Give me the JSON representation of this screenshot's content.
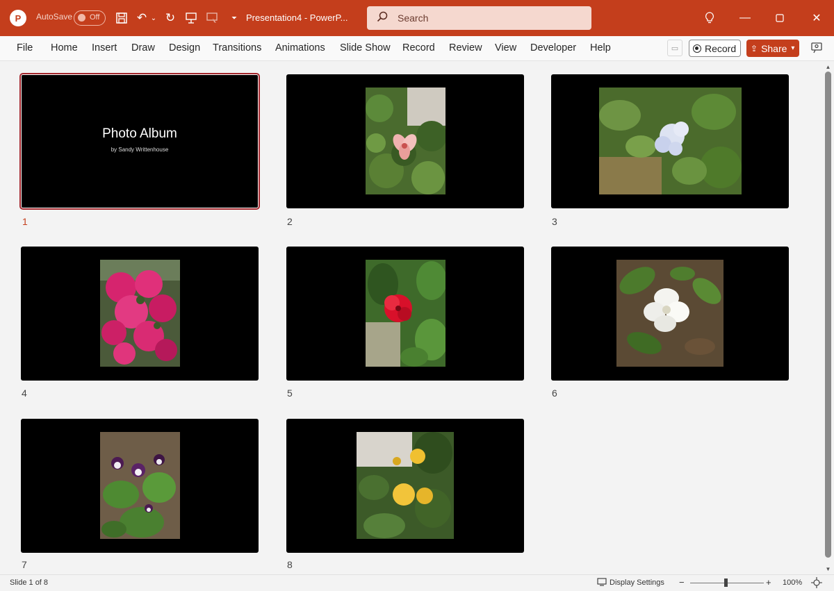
{
  "titlebar": {
    "app_icon": "powerpoint-logo",
    "autosave_label": "AutoSave",
    "autosave_state": "Off",
    "doc_title": "Presentation4  -  PowerP...",
    "search_placeholder": "Search",
    "icons": [
      "save-icon",
      "undo-icon",
      "redo-icon",
      "present-icon",
      "slideshow-icon",
      "customize-qat-icon",
      "lightbulb-icon",
      "minimize-icon",
      "maximize-icon",
      "close-icon"
    ]
  },
  "menu": {
    "items": [
      "File",
      "Home",
      "Insert",
      "Draw",
      "Design",
      "Transitions",
      "Animations",
      "Slide Show",
      "Record",
      "Review",
      "View",
      "Developer",
      "Help"
    ],
    "record_label": "Record",
    "share_label": "Share"
  },
  "slides": [
    {
      "num": "1",
      "title": "Photo Album",
      "subtitle": "by Sandy Writtenhouse"
    },
    {
      "num": "2",
      "photo": "pink lily among green leaves"
    },
    {
      "num": "3",
      "photo": "pale blue plumbago on leaves"
    },
    {
      "num": "4",
      "photo": "magenta bougainvillea bush"
    },
    {
      "num": "5",
      "photo": "red hibiscus flower"
    },
    {
      "num": "6",
      "photo": "white gardenia flower"
    },
    {
      "num": "7",
      "photo": "purple and white torenia flowers"
    },
    {
      "num": "8",
      "photo": "yellow ixora flower clusters"
    }
  ],
  "status": {
    "slide_info": "Slide 1 of 8",
    "display_settings": "Display Settings",
    "zoom_minus": "−",
    "zoom_plus": "+",
    "zoom_level": "100%"
  },
  "colors": {
    "accent": "#c43e1c",
    "selection": "#a4262c"
  }
}
